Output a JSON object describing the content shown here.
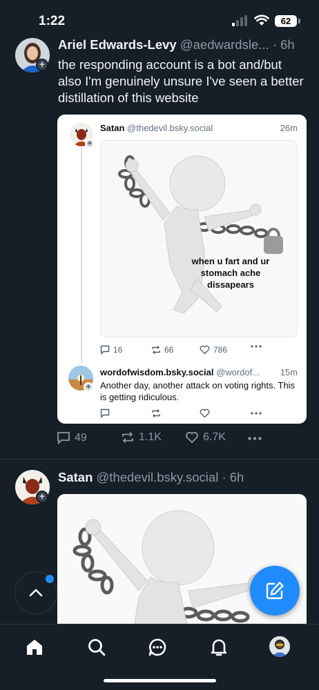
{
  "status_bar": {
    "time": "1:22",
    "battery": "62"
  },
  "post1": {
    "author_name": "Ariel Edwards-Levy",
    "author_handle": "@aedwardsle...",
    "time": "· 6h",
    "text": "the responding account is a bot and/but also I'm genuinely unsure I've seen a better distillation of this website",
    "quote": {
      "author_name": "Satan",
      "author_handle": "@thedevil.bsky.social",
      "time": "26m",
      "image_caption": "when u fart and ur stomach ache dissapears",
      "replies": "16",
      "reposts": "66",
      "likes": "786",
      "reply": {
        "author_name": "wordofwisdom.bsky.social",
        "author_handle": "@wordof...",
        "time": "15m",
        "text": "Another day, another attack on voting rights. This is getting ridiculous."
      }
    },
    "replies": "49",
    "reposts": "1.1K",
    "likes": "6.7K"
  },
  "post2": {
    "author_name": "Satan",
    "author_handle": "@thedevil.bsky.social",
    "time": "· 6h"
  },
  "nav": [
    "home-icon",
    "search-icon",
    "chat-icon",
    "bell-icon",
    "profile-avatar"
  ],
  "colors": {
    "background": "#161e27",
    "accent": "#208bfe",
    "muted": "#8d98a5"
  }
}
